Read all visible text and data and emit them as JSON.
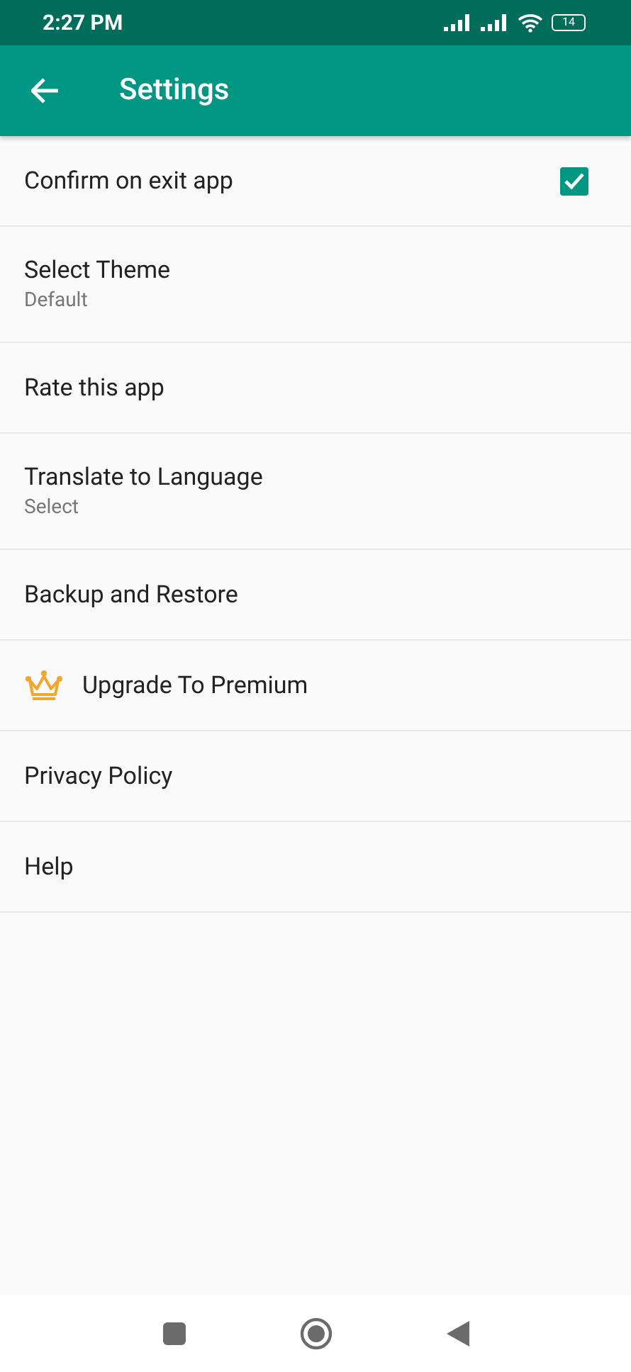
{
  "status_bar": {
    "time": "2:27 PM",
    "battery": "14"
  },
  "toolbar": {
    "title": "Settings"
  },
  "items": [
    {
      "kind": "checkbox",
      "label": "Confirm on exit app",
      "checked": true
    },
    {
      "kind": "plain",
      "label": "Select Theme",
      "subtitle": "Default"
    },
    {
      "kind": "plain",
      "label": "Rate this app"
    },
    {
      "kind": "plain",
      "label": "Translate to Language",
      "subtitle": "Select"
    },
    {
      "kind": "plain",
      "label": "Backup and Restore"
    },
    {
      "kind": "premium",
      "label": "Upgrade To Premium"
    },
    {
      "kind": "plain",
      "label": "Privacy Policy"
    },
    {
      "kind": "plain",
      "label": "Help"
    }
  ]
}
